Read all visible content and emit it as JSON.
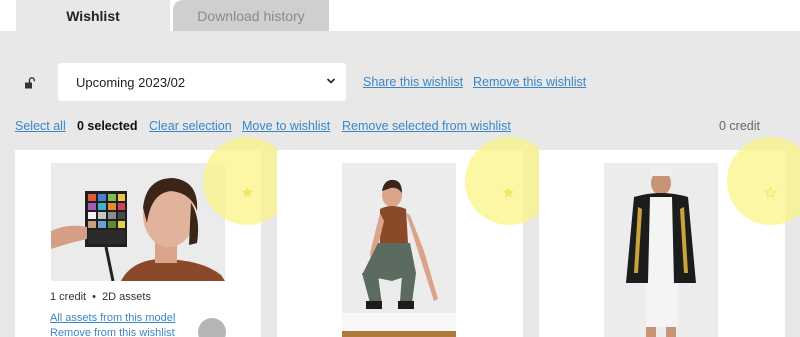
{
  "tabs": [
    {
      "label": "Wishlist",
      "active": true
    },
    {
      "label": "Download history",
      "active": false
    }
  ],
  "wishlist_select": {
    "value": "Upcoming 2023/02"
  },
  "actions": {
    "share": "Share this wishlist",
    "remove": "Remove this wishlist"
  },
  "selection_bar": {
    "select_all": "Select all",
    "selected_count": "0 selected",
    "clear": "Clear selection",
    "move": "Move to wishlist",
    "remove_selected": "Remove selected from wishlist",
    "credits": "0 credit"
  },
  "cards": [
    {
      "credit": "1 credit",
      "separator": "•",
      "assets": "2D assets",
      "all_assets_link": "All assets from this model",
      "remove_link": "Remove from this wishlist",
      "starred": true
    },
    {
      "starred": true
    },
    {
      "starred": false
    }
  ],
  "colors": {
    "link": "#3a86c8",
    "panel": "#e8e8e8",
    "star": "#e6c21a",
    "highlight": "#faf482"
  },
  "icons": {
    "lock": "unlocked-padlock-icon",
    "dropdown": "chevron-down-icon",
    "star_filled": "star-filled-icon",
    "star_outline": "star-outline-icon"
  }
}
